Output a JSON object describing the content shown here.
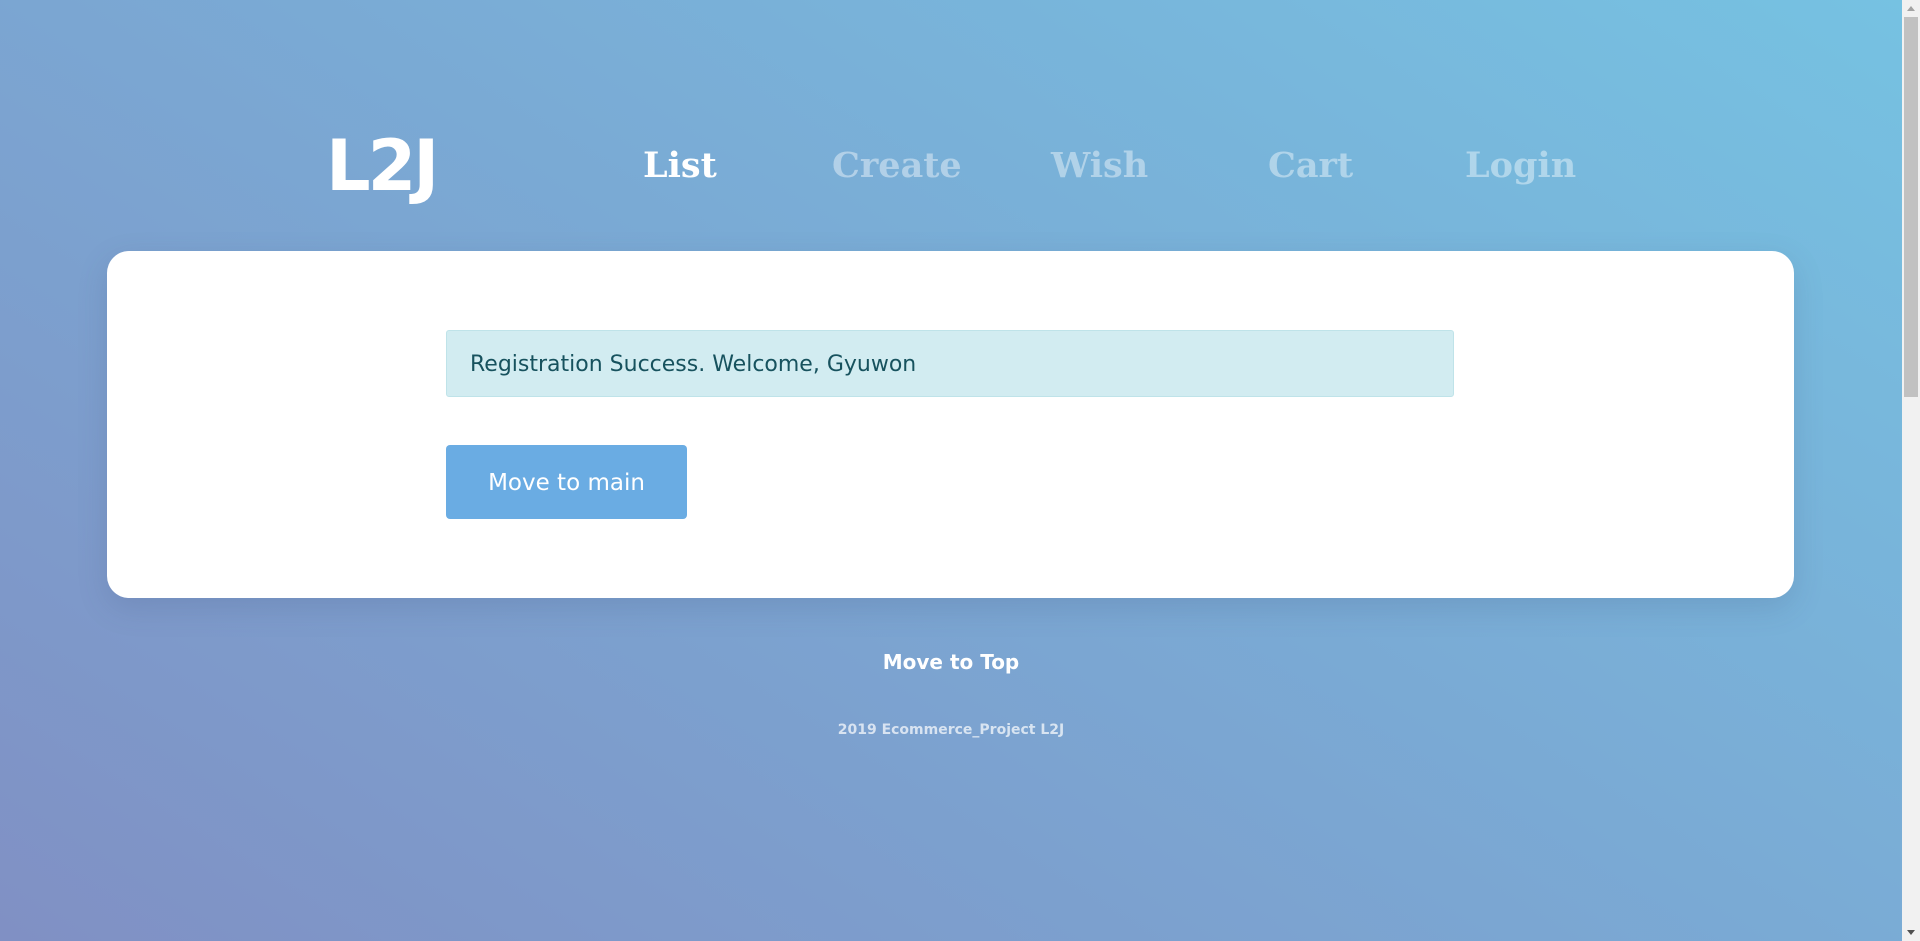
{
  "header": {
    "logo": "L2J",
    "nav": [
      {
        "label": "List",
        "active": true
      },
      {
        "label": "Create",
        "active": false
      },
      {
        "label": "Wish",
        "active": false
      },
      {
        "label": "Cart",
        "active": false
      },
      {
        "label": "Login",
        "active": false
      }
    ]
  },
  "main": {
    "alert_text": "Registration Success. Welcome, Gyuwon",
    "button_label": "Move to main"
  },
  "footer": {
    "move_top": "Move to Top",
    "copyright": "2019 Ecommerce_Project L2J"
  },
  "colors": {
    "accent_button": "#6aace3",
    "alert_bg": "#d2ecf1",
    "alert_text": "#17525e"
  }
}
